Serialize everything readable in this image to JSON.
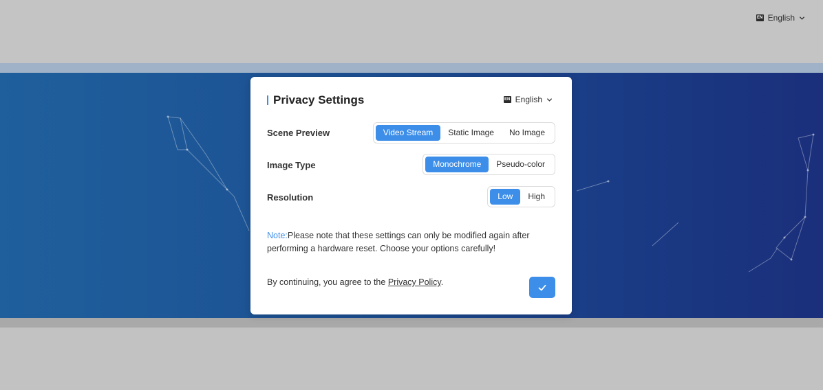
{
  "header": {
    "language_icon": "EN",
    "language": "English"
  },
  "dialog": {
    "title": "Privacy Settings",
    "language_icon": "EN",
    "language": "English",
    "settings": [
      {
        "label": "Scene Preview",
        "options": [
          "Video Stream",
          "Static Image",
          "No Image"
        ],
        "selected": "Video Stream"
      },
      {
        "label": "Image Type",
        "options": [
          "Monochrome",
          "Pseudo-color"
        ],
        "selected": "Monochrome"
      },
      {
        "label": "Resolution",
        "options": [
          "Low",
          "High"
        ],
        "selected": "Low"
      }
    ],
    "note_prefix": "Note:",
    "note_text": "Please note that these settings can only be modified again after performing a hardware reset. Choose your options carefully!",
    "agree_text": "By continuing, you agree to the ",
    "policy_link": "Privacy Policy",
    "agree_suffix": ".",
    "confirm_icon": "check-icon"
  },
  "colors": {
    "accent": "#3d8ee8",
    "band_left": "#1f5f9c",
    "band_right": "#1b2f7b"
  }
}
